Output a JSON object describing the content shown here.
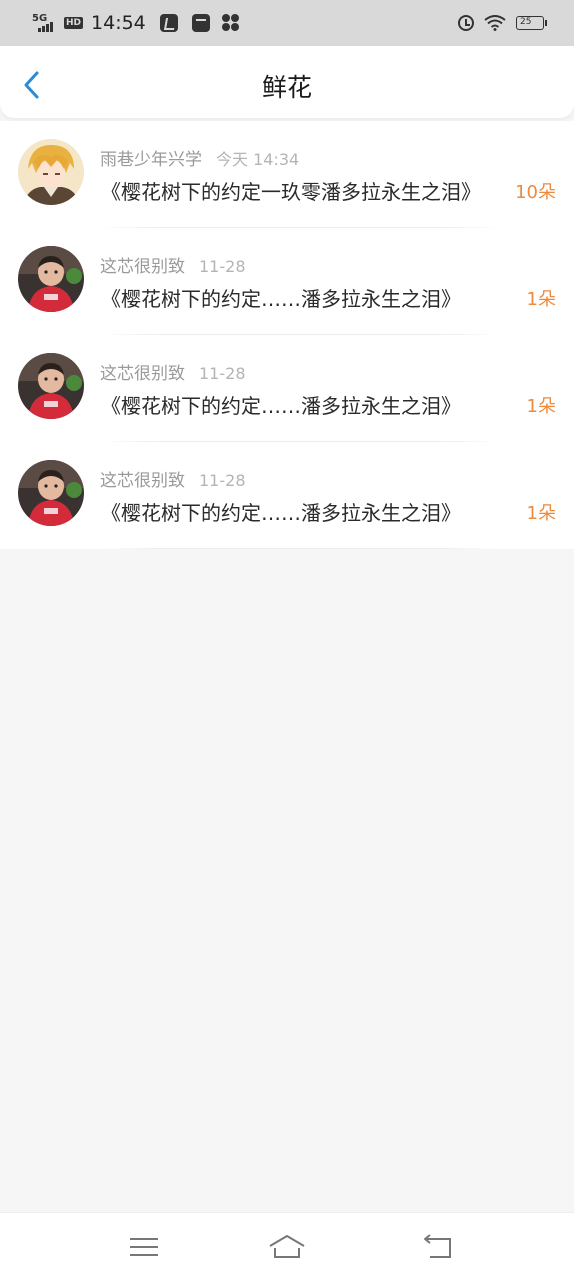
{
  "status": {
    "network": "5G",
    "hd": "HD",
    "time": "14:54",
    "battery": "25",
    "icons": [
      "app-b-icon",
      "mail-icon",
      "clover-icon",
      "alarm-icon",
      "wifi-icon",
      "battery-icon"
    ]
  },
  "header": {
    "title": "鲜花",
    "back_icon": "chevron-left-icon",
    "accent": "#2a8bd8"
  },
  "list": [
    {
      "name": "雨巷少年兴学",
      "time": "今天 14:34",
      "text": "《樱花树下的约定一玖零潘多拉永生之泪》",
      "count": "10朵"
    },
    {
      "name": "这芯很别致",
      "time": "11-28",
      "text": "《樱花树下的约定……潘多拉永生之泪》",
      "count": "1朵"
    },
    {
      "name": "这芯很别致",
      "time": "11-28",
      "text": "《樱花树下的约定……潘多拉永生之泪》",
      "count": "1朵"
    },
    {
      "name": "这芯很别致",
      "time": "11-28",
      "text": "《樱花树下的约定……潘多拉永生之泪》",
      "count": "1朵"
    }
  ],
  "count_color": "#ee8a3c",
  "bottom_nav": [
    "menu-icon",
    "home-icon",
    "back-icon"
  ]
}
